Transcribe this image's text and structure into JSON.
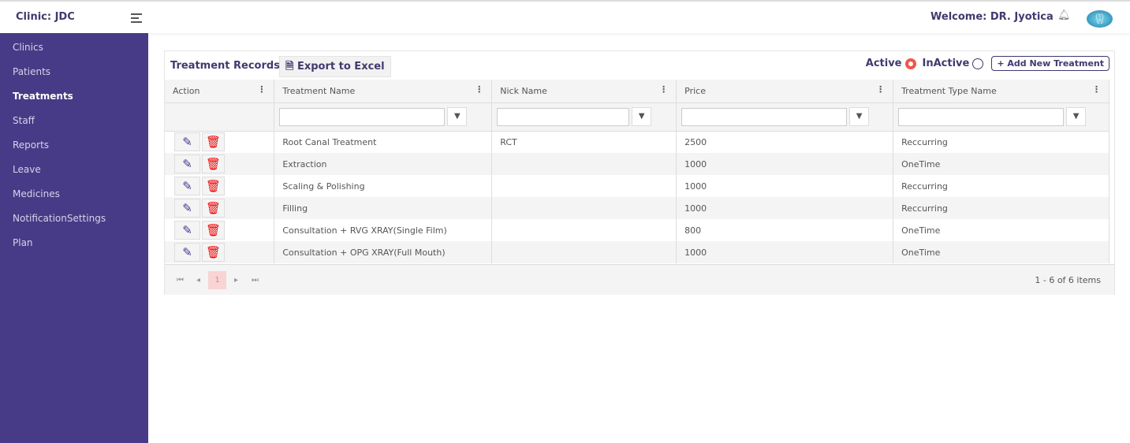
{
  "header": {
    "clinic": "Clinic: JDC",
    "welcome": "Welcome: DR. Jyotica"
  },
  "sidebar": {
    "items": [
      "Clinics",
      "Patients",
      "Treatments",
      "Staff",
      "Reports",
      "Leave",
      "Medicines",
      "NotificationSettings",
      "Plan"
    ],
    "active": "Treatments"
  },
  "panel": {
    "title": "Treatment Records",
    "export_label": "Export to Excel",
    "active_label": "Active",
    "inactive_label": "InActive",
    "add_label": "Add New Treatment"
  },
  "columns": [
    "Action",
    "Treatment Name",
    "Nick Name",
    "Price",
    "Treatment Type Name"
  ],
  "rows": [
    {
      "name": "Root Canal Treatment",
      "nick": "RCT",
      "price": "2500",
      "type": "Reccurring"
    },
    {
      "name": "Extraction",
      "nick": "",
      "price": "1000",
      "type": "OneTime"
    },
    {
      "name": "Scaling & Polishing",
      "nick": "",
      "price": "1000",
      "type": "Reccurring"
    },
    {
      "name": "Filling",
      "nick": "",
      "price": "1000",
      "type": "Reccurring"
    },
    {
      "name": "Consultation + RVG XRAY(Single Film)",
      "nick": "",
      "price": "800",
      "type": "OneTime"
    },
    {
      "name": "Consultation + OPG XRAY(Full Mouth)",
      "nick": "",
      "price": "1000",
      "type": "OneTime"
    }
  ],
  "pager": {
    "page": "1",
    "info": "1 - 6 of 6 items"
  }
}
